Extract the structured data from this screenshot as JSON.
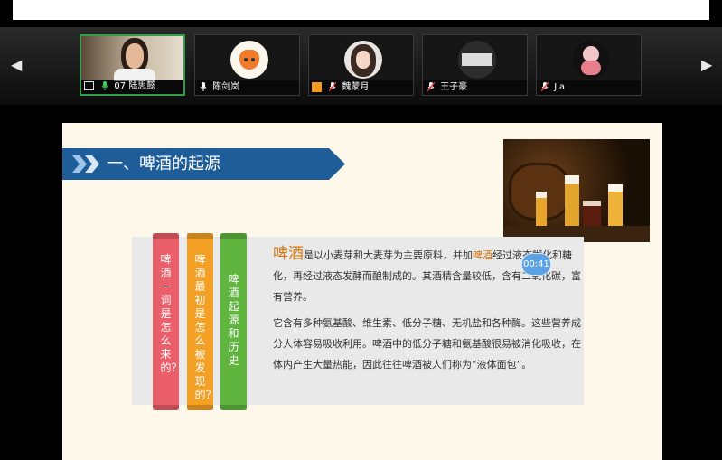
{
  "participants": [
    {
      "name": "07 陆思懿",
      "active": true
    },
    {
      "name": "陈剑岚"
    },
    {
      "name": "魏蒙月"
    },
    {
      "name": "王子豪"
    },
    {
      "name": "Jia"
    }
  ],
  "slide": {
    "title": "一、啤酒的起源",
    "tabs": [
      {
        "text": "啤酒一词是怎么来的？",
        "color": "#ea5f6a"
      },
      {
        "text": "啤酒最初是怎么被发现的？",
        "color": "#f4a025"
      },
      {
        "text": "啤酒起源和历史",
        "color": "#5fb53e"
      }
    ],
    "para1_lead": "啤酒",
    "para1_a": "是以小麦芽和大麦芽为主要原料，并加",
    "para1_hl": "啤酒",
    "para1_b": "经过液态糊化和糖化，再经过液态发酵而酿制成的。其酒精含量较低，含有二氧化碳，富有营养。",
    "para2": "它含有多种氨基酸、维生素、低分子糖、无机盐和各种酶。这些营养成分人体容易吸收利用。啤酒中的低分子糖和氨基酸很易被消化吸收，在体内产生大量热能，因此往往啤酒被人们称为“液体面包”。"
  },
  "timer": "00:41",
  "colors": {
    "ribbon": "#1e5d98",
    "accent": "#d4760f",
    "active_border": "#2f9e4a"
  }
}
